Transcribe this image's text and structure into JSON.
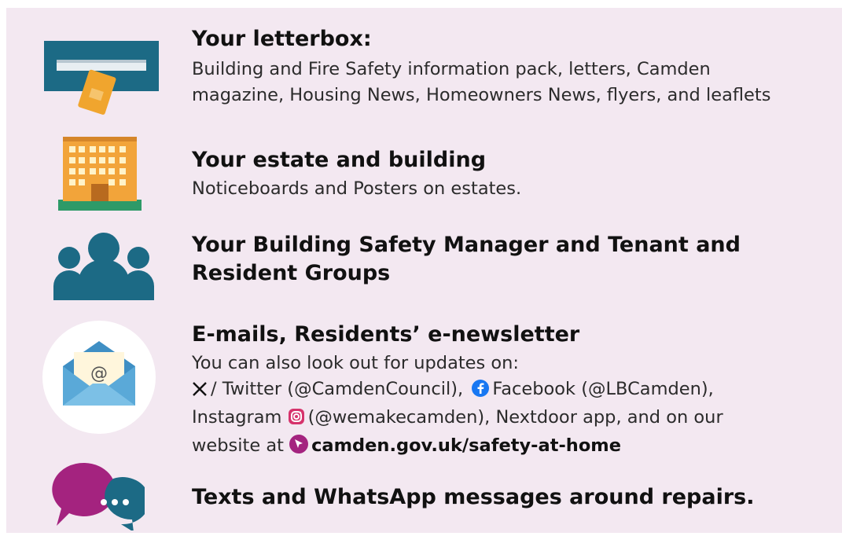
{
  "colors": {
    "background": "#f3e8f1",
    "teal": "#1c6a85",
    "magenta": "#a4237f",
    "orange": "#f2a43a",
    "green": "#2e9a68",
    "light_blue": "#5aa9d8"
  },
  "sections": [
    {
      "icon": "letterbox-icon",
      "title": "Your letterbox:",
      "lines": [
        "Building and Fire Safety information pack, letters, Camden",
        "magazine, Housing News, Homeowners News, flyers, and leaflets"
      ]
    },
    {
      "icon": "building-icon",
      "title": "Your estate and building",
      "lines": [
        "Noticeboards and Posters on estates."
      ]
    },
    {
      "icon": "people-group-icon",
      "title_lines": [
        "Your Building Safety Manager and Tenant and",
        "Resident Groups"
      ]
    },
    {
      "icon": "email-envelope-icon",
      "title": "E-mails, Residents’ e-newsletter",
      "line1": "You can also look out for updates on:",
      "twitter": "/ Twitter (@CamdenCouncil),",
      "facebook": "Facebook (@LBCamden),",
      "instagram_label": "Instagram",
      "instagram_rest": "(@wemakecamden), Nextdoor app, and on our",
      "website_prefix": "website at",
      "website_url": "camden.gov.uk/safety-at-home"
    },
    {
      "icon": "chat-bubbles-icon",
      "title": "Texts and WhatsApp messages around repairs."
    }
  ]
}
